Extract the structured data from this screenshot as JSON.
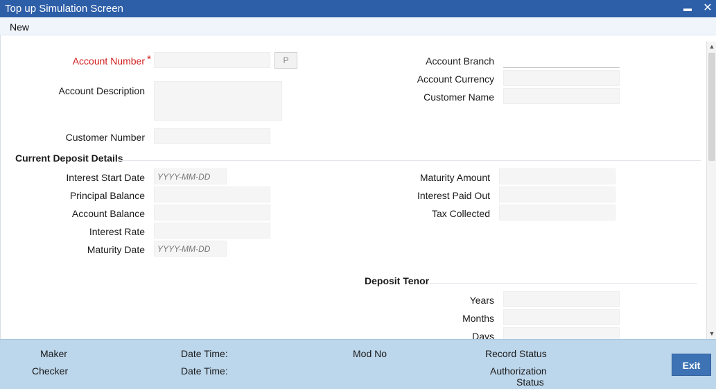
{
  "window": {
    "title": "Top up Simulation Screen",
    "minimize_glyph": "▬",
    "close_glyph": "✕"
  },
  "menu": {
    "new_label": "New"
  },
  "form": {
    "account_number": {
      "label": "Account Number",
      "required_mark": "*",
      "value": "",
      "lookup_button": "P"
    },
    "account_description": {
      "label": "Account Description",
      "value": ""
    },
    "customer_number": {
      "label": "Customer Number",
      "value": ""
    },
    "account_branch": {
      "label": "Account Branch",
      "value": ""
    },
    "account_currency": {
      "label": "Account Currency",
      "value": ""
    },
    "customer_name": {
      "label": "Customer Name",
      "value": ""
    }
  },
  "current_deposit": {
    "heading": "Current Deposit Details",
    "interest_start_date": {
      "label": "Interest Start Date",
      "placeholder": "YYYY-MM-DD"
    },
    "principal_balance": {
      "label": "Principal Balance",
      "value": ""
    },
    "account_balance": {
      "label": "Account Balance",
      "value": ""
    },
    "interest_rate": {
      "label": "Interest Rate",
      "value": ""
    },
    "maturity_date": {
      "label": "Maturity Date",
      "placeholder": "YYYY-MM-DD"
    },
    "maturity_amount": {
      "label": "Maturity Amount",
      "value": ""
    },
    "interest_paid_out": {
      "label": "Interest Paid Out",
      "value": ""
    },
    "tax_collected": {
      "label": "Tax Collected",
      "value": ""
    }
  },
  "deposit_tenor": {
    "heading": "Deposit Tenor",
    "years": {
      "label": "Years",
      "value": ""
    },
    "months": {
      "label": "Months",
      "value": ""
    },
    "days": {
      "label": "Days",
      "value": ""
    }
  },
  "footer": {
    "maker": "Maker",
    "checker": "Checker",
    "date_time_1": "Date Time:",
    "date_time_2": "Date Time:",
    "mod_no": "Mod No",
    "record_status": "Record Status",
    "authorization_status_line1": "Authorization",
    "authorization_status_line2": "Status",
    "exit_label": "Exit"
  },
  "scrollbar": {
    "up_glyph": "▲",
    "down_glyph": "▼"
  },
  "colors": {
    "titlebar": "#2d5ea8",
    "footer": "#bcd6eb",
    "required_label": "#d11a1a",
    "exit_button": "#3d73b5"
  }
}
